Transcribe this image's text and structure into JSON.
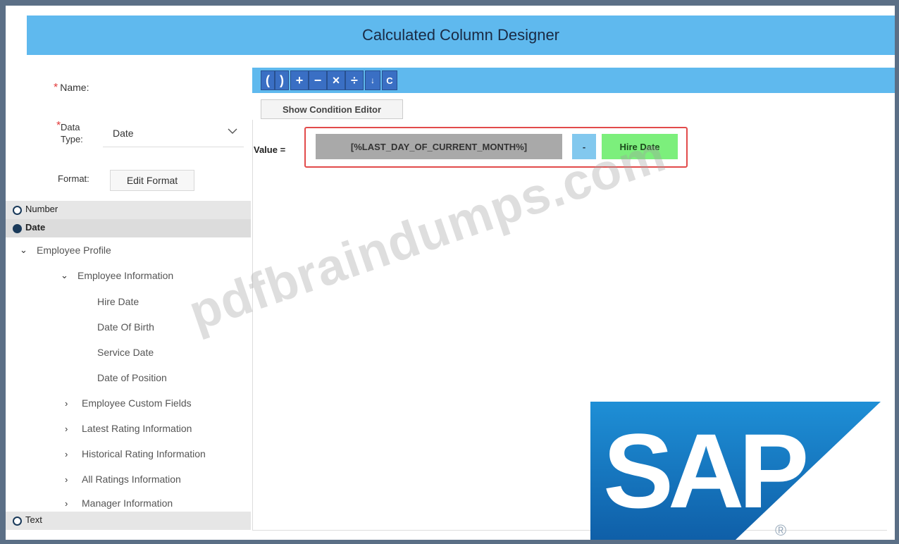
{
  "window": {
    "title": "Calculated Column Designer"
  },
  "form": {
    "name_label": "Name:",
    "data_type_label_1": "Data",
    "data_type_label_2": "Type:",
    "data_type_value": "Date",
    "format_label": "Format:",
    "edit_format_button": "Edit Format"
  },
  "type_options": [
    {
      "label": "Number",
      "selected": false
    },
    {
      "label": "Date",
      "selected": true
    },
    {
      "label": "Text",
      "selected": false
    }
  ],
  "tree": {
    "employee_profile": "Employee Profile",
    "employee_information": "Employee Information",
    "leaves": [
      "Hire Date",
      "Date Of Birth",
      "Service Date",
      "Date of Position"
    ],
    "sections": [
      "Employee Custom Fields",
      "Latest Rating Information",
      "Historical Rating Information",
      "All Ratings Information",
      "Manager Information"
    ]
  },
  "toolbar": {
    "buttons": [
      "(",
      ")",
      "+",
      "−",
      "×",
      "÷",
      "↓",
      "C"
    ]
  },
  "editor": {
    "condition_button": "Show Condition Editor",
    "value_label": "Value =",
    "tokens": [
      {
        "text": "[%LAST_DAY_OF_CURRENT_MONTH%]",
        "color": "#a9a9a9"
      },
      {
        "text": "-",
        "color": "#82c8ee"
      },
      {
        "text": "Hire Date",
        "color": "#7cef7c"
      }
    ]
  },
  "watermark": "pdfbraindumps.com",
  "logo": {
    "text": "SAP",
    "mark": "®"
  },
  "colors": {
    "accent": "#5fb9ee",
    "highlight_border": "#e24b4b"
  }
}
